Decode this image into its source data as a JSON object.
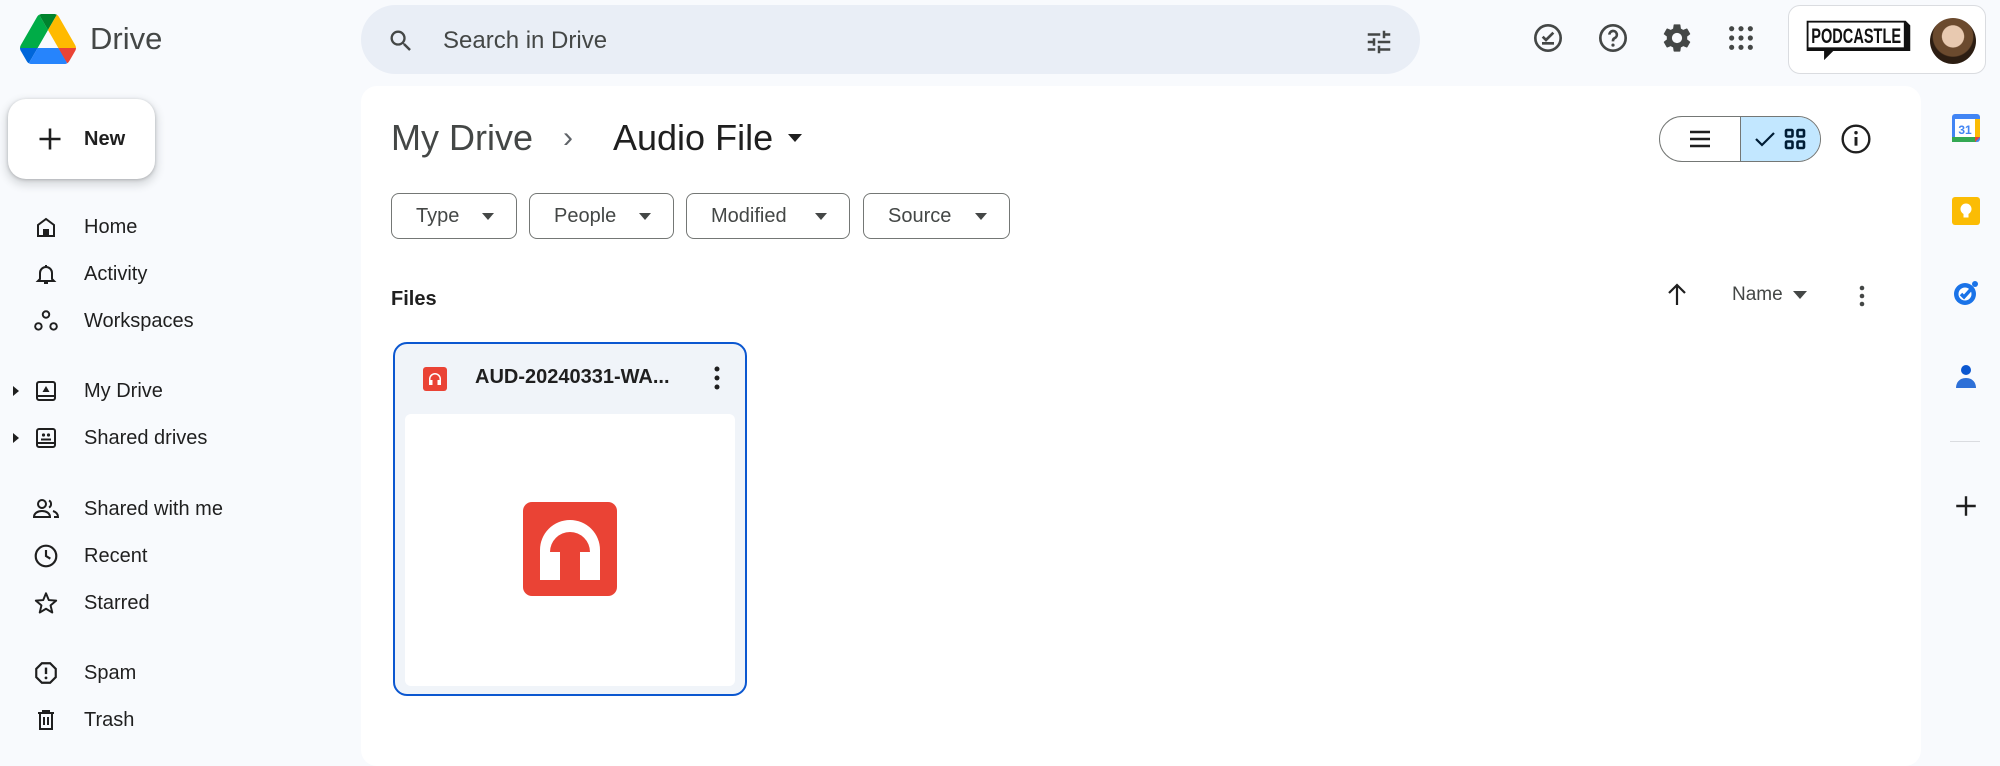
{
  "app": {
    "name": "Drive"
  },
  "search": {
    "placeholder": "Search in Drive"
  },
  "header_icons": [
    "ready-for-offline-icon",
    "help-icon",
    "settings-icon",
    "apps-grid-icon"
  ],
  "account": {
    "org_logo_text": "PODCASTLE"
  },
  "new_button": {
    "label": "New"
  },
  "sidebar": {
    "items": [
      {
        "label": "Home",
        "icon": "home-icon"
      },
      {
        "label": "Activity",
        "icon": "bell-icon"
      },
      {
        "label": "Workspaces",
        "icon": "workspaces-icon"
      },
      {
        "label": "My Drive",
        "icon": "my-drive-icon",
        "expandable": true
      },
      {
        "label": "Shared drives",
        "icon": "shared-drives-icon",
        "expandable": true
      },
      {
        "label": "Shared with me",
        "icon": "people-icon"
      },
      {
        "label": "Recent",
        "icon": "clock-icon"
      },
      {
        "label": "Starred",
        "icon": "star-icon"
      },
      {
        "label": "Spam",
        "icon": "spam-icon"
      },
      {
        "label": "Trash",
        "icon": "trash-icon"
      }
    ]
  },
  "breadcrumb": {
    "root": "My Drive",
    "separator": "›",
    "current": "Audio File"
  },
  "filters": [
    {
      "label": "Type"
    },
    {
      "label": "People"
    },
    {
      "label": "Modified"
    },
    {
      "label": "Source"
    }
  ],
  "view": {
    "mode": "grid"
  },
  "files_section": {
    "label": "Files",
    "sort_by": "Name",
    "sort_direction": "ascending"
  },
  "files": [
    {
      "name": "AUD-20240331-WA...",
      "type": "audio"
    }
  ],
  "right_rail": [
    "calendar-icon",
    "keep-icon",
    "tasks-icon",
    "contacts-icon",
    "add-icon"
  ],
  "colors": {
    "accent": "#0b57d0",
    "selected_toggle": "#c2e7ff",
    "audio_red": "#ea4335",
    "search_bg": "#e9eef6"
  }
}
